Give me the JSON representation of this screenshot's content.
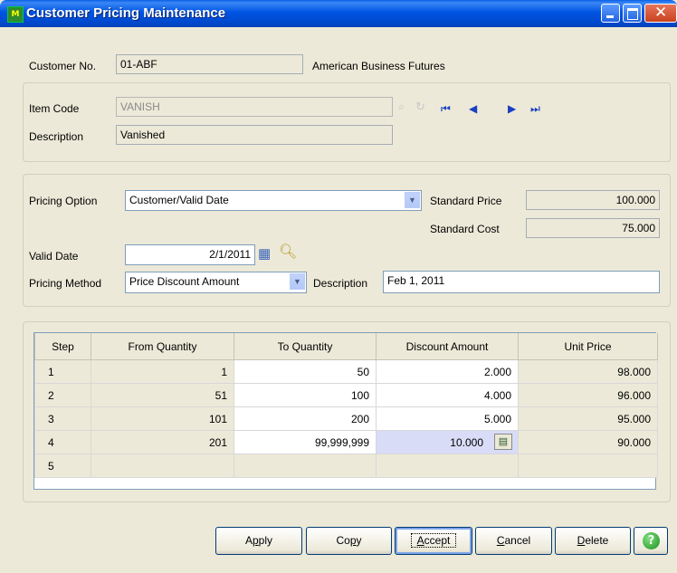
{
  "window": {
    "title": "Customer Pricing Maintenance",
    "app_icon": "M"
  },
  "header": {
    "customer_no_label": "Customer No.",
    "customer_no": "01-ABF",
    "customer_name": "American Business Futures"
  },
  "item": {
    "item_code_label": "Item Code",
    "item_code": "VANISH",
    "description_label": "Description",
    "description": "Vanished",
    "nav": {
      "first": "⏮",
      "prev": "◀",
      "next": "▶",
      "last": "⏭"
    }
  },
  "pricing": {
    "option_label": "Pricing Option",
    "option_value": "Customer/Valid Date",
    "standard_price_label": "Standard Price",
    "standard_price": "100.000",
    "standard_cost_label": "Standard Cost",
    "standard_cost": "75.000",
    "valid_date_label": "Valid Date",
    "valid_date": "2/1/2011",
    "method_label": "Pricing Method",
    "method_value": "Price Discount Amount",
    "description_label": "Description",
    "description": "Feb 1, 2011"
  },
  "grid": {
    "columns": [
      "Step",
      "From Quantity",
      "To Quantity",
      "Discount Amount",
      "Unit Price"
    ],
    "rows": [
      [
        "1",
        "1",
        "50",
        "2.000",
        "98.000"
      ],
      [
        "2",
        "51",
        "100",
        "4.000",
        "96.000"
      ],
      [
        "3",
        "101",
        "200",
        "5.000",
        "95.000"
      ],
      [
        "4",
        "201",
        "99,999,999",
        "10.000",
        "90.000"
      ],
      [
        "5",
        "",
        "",
        "",
        ""
      ]
    ]
  },
  "buttons": {
    "apply": {
      "pre": "A",
      "u": "p",
      "post": "ply"
    },
    "copy": {
      "pre": "Co",
      "u": "p",
      "post": "y"
    },
    "accept": {
      "pre": "",
      "u": "A",
      "post": "ccept"
    },
    "cancel": {
      "pre": "",
      "u": "C",
      "post": "ancel"
    },
    "delete": {
      "pre": "",
      "u": "D",
      "post": "elete"
    },
    "help": "?"
  },
  "colors": {
    "title_bar": "#0054e3",
    "window_bg": "#ece9d8",
    "selected_cell": "#d9dcf7"
  }
}
